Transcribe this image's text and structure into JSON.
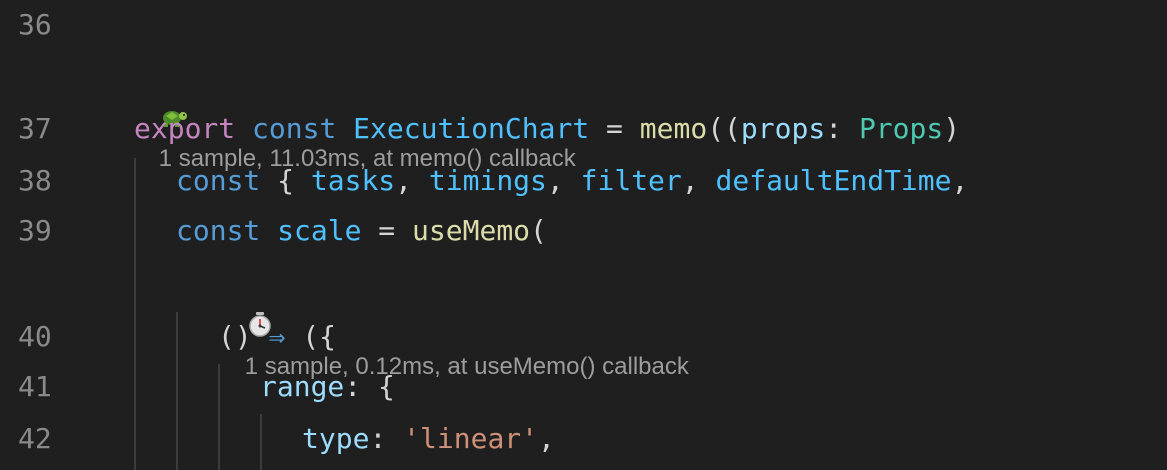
{
  "editor": {
    "lines": [
      {
        "num": "36"
      },
      {
        "num": "37",
        "t": [
          "export",
          " ",
          "const",
          " ",
          "ExecutionChart",
          " = ",
          "memo",
          "((",
          "props",
          ": ",
          "Props",
          ")"
        ]
      },
      {
        "num": "38",
        "t": [
          "const",
          " { ",
          "tasks",
          ", ",
          "timings",
          ", ",
          "filter",
          ", ",
          "defaultEndTime",
          ","
        ]
      },
      {
        "num": "39",
        "t": [
          "const",
          " ",
          "scale",
          " = ",
          "useMemo",
          "("
        ]
      },
      {
        "num": "40",
        "t": [
          "()",
          " ",
          "⇒",
          " ({"
        ]
      },
      {
        "num": "41",
        "t": [
          "range",
          ": {"
        ]
      },
      {
        "num": "42",
        "t": [
          "type",
          ": ",
          "'linear'",
          ","
        ]
      }
    ],
    "hints": [
      {
        "icon": "turtle-icon",
        "text": "1 sample, 11.03ms, at memo() callback"
      },
      {
        "icon": "stopwatch-icon",
        "text": "1 sample, 0.12ms, at useMemo() callback"
      }
    ]
  },
  "colors": {
    "background": "#1f1f1f",
    "line_number": "#8a8a8a",
    "keyword_export": "#c586c0",
    "keyword_const": "#569cd6",
    "variable": "#4fc1ff",
    "function": "#dcdcaa",
    "parameter": "#9cdcfe",
    "type": "#4ec9b0",
    "string": "#ce9178",
    "hint_text": "#9d9d9d"
  }
}
